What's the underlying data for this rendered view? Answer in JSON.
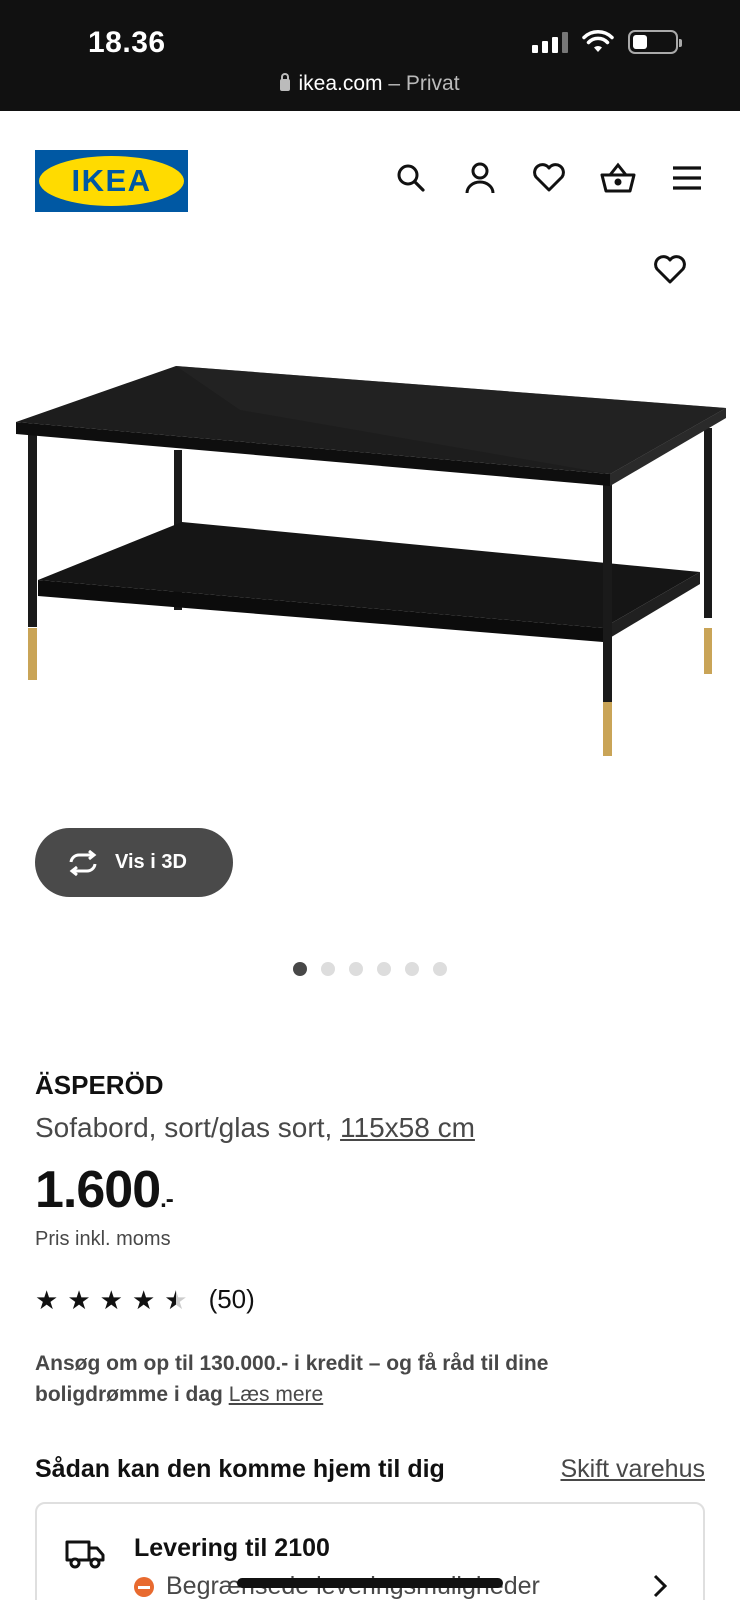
{
  "status_bar": {
    "time": "18.36",
    "url": "ikea.com",
    "url_suffix": " – Privat"
  },
  "header": {
    "logo_text": "IKEA",
    "brand_colors": {
      "blue": "#0058a3",
      "yellow": "#ffdb00"
    },
    "icons": [
      "search-icon",
      "account-icon",
      "heart-icon",
      "basket-icon",
      "menu-icon"
    ]
  },
  "gallery": {
    "view_3d_label": "Vis i 3D",
    "dot_count": 6,
    "active_dot": 1
  },
  "product": {
    "name": "ÄSPERÖD",
    "description": "Sofabord, sort/glas sort, ",
    "dimensions": "115x58 cm",
    "price": "1.600",
    "price_suffix": ".-",
    "vat_note": "Pris inkl. moms",
    "rating": 4.5,
    "review_count": "(50)"
  },
  "credit": {
    "text": "Ansøg om op til 130.000.- i kredit – og få råd til dine boligdrømme i dag",
    "link": "Læs mere"
  },
  "delivery": {
    "section_title": "Sådan kan den komme hjem til dig",
    "switch_store": "Skift varehus",
    "title": "Levering til 2100",
    "status": "Begrænsede leveringsmuligheder",
    "status_color": "#e86a2f"
  }
}
